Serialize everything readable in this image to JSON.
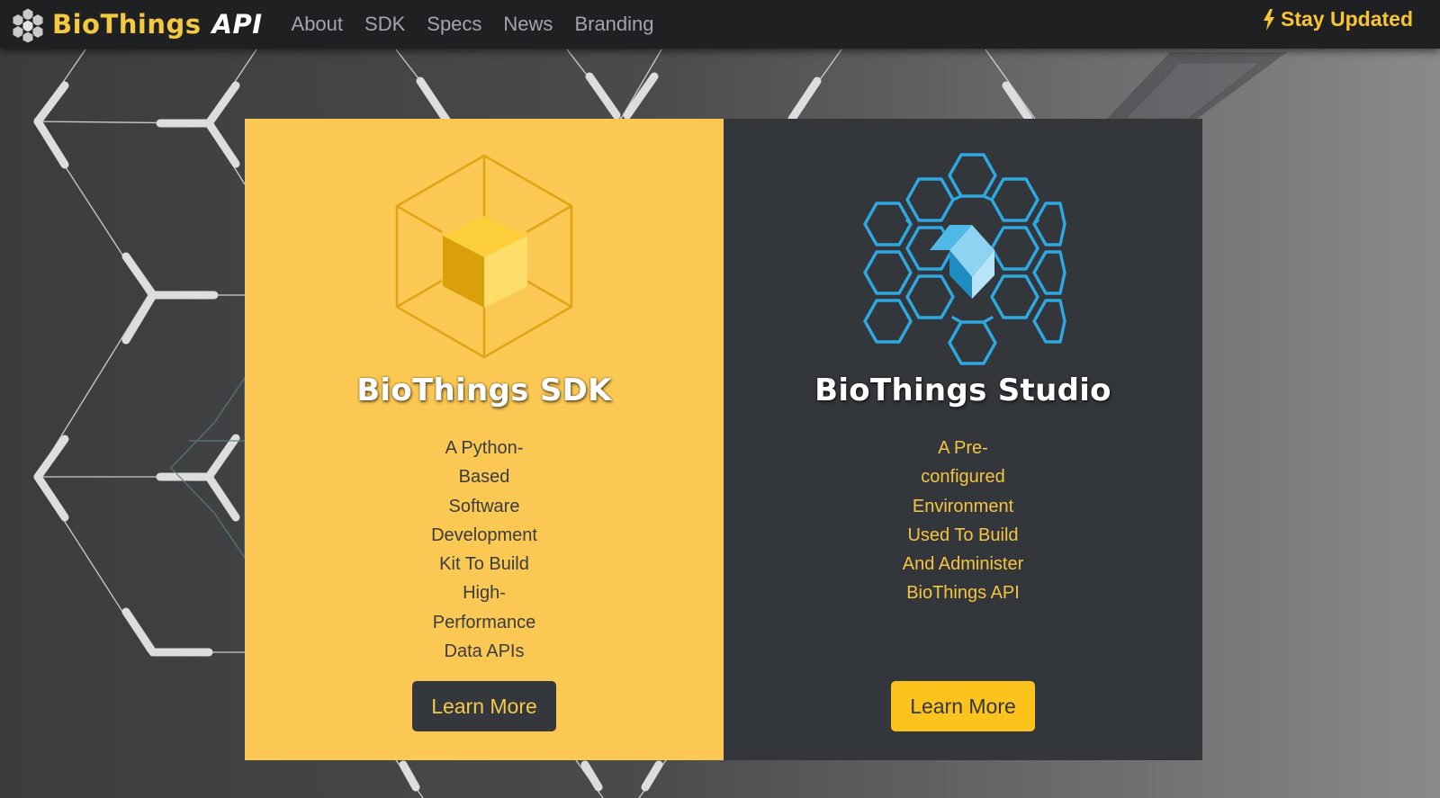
{
  "navbar": {
    "brand_name": "BioThings",
    "brand_suffix": "API",
    "logo_icon": "hexagon-cluster-logo-icon",
    "links": [
      "About",
      "SDK",
      "Specs",
      "News",
      "Branding"
    ],
    "stay_updated_label": "Stay Updated",
    "stay_updated_icon": "lightning-bolt-icon"
  },
  "cards": {
    "sdk": {
      "icon": "wireframe-cube-icon",
      "title": "BioThings SDK",
      "description": "A Python-Based Software Development Kit To Build High-Performance Data APIs",
      "button_label": "Learn More",
      "background": "#fbc853"
    },
    "studio": {
      "icon": "hexagon-network-icon",
      "title": "BioThings Studio",
      "description": "A Pre-configured Environment Used To Build And Administer BioThings API",
      "button_label": "Learn More",
      "background": "#33363b"
    }
  },
  "colors": {
    "accent_yellow": "#f5c842",
    "dark_panel": "#33363b",
    "navbar_bg": "#1f2022",
    "studio_blue": "#2ea8e0"
  }
}
